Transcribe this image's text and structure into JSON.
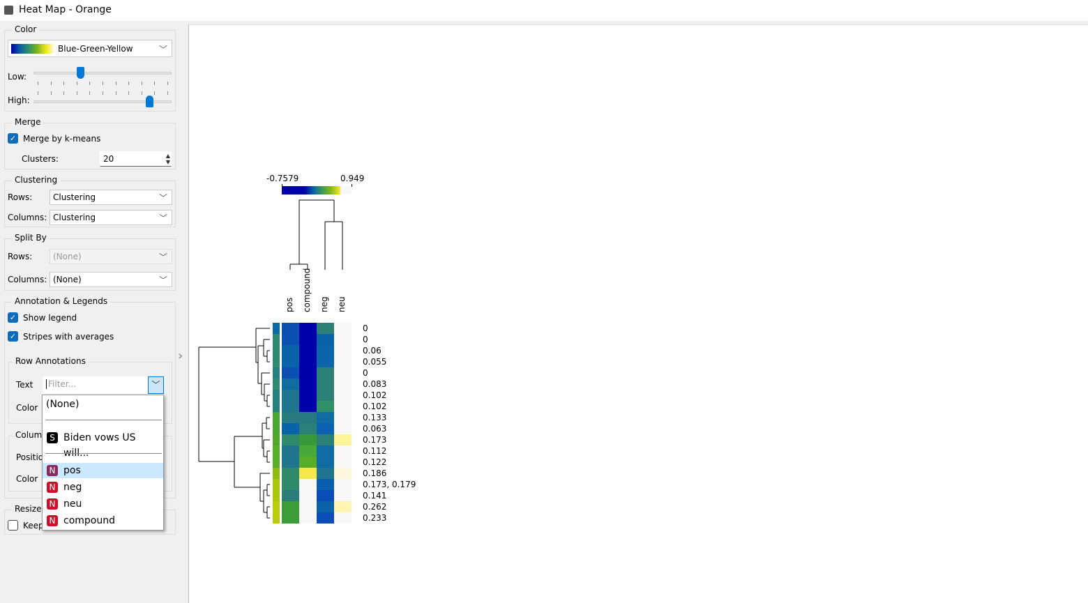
{
  "window": {
    "title": "Heat Map - Orange",
    "icon": "orange-app-icon"
  },
  "color": {
    "section": "Color",
    "palette": "Blue-Green-Yellow",
    "low_label": "Low:",
    "high_label": "High:",
    "low_value": 0.35,
    "high_value": 0.85
  },
  "merge": {
    "section": "Merge",
    "checkbox": "Merge by k-means",
    "checked": true,
    "clusters_label": "Clusters:",
    "clusters": "20"
  },
  "clustering": {
    "section": "Clustering",
    "rows_label": "Rows:",
    "rows": "Clustering",
    "columns_label": "Columns:",
    "columns": "Clustering"
  },
  "split": {
    "section": "Split By",
    "rows_label": "Rows:",
    "rows": "(None)",
    "columns_label": "Columns:",
    "columns": "(None)"
  },
  "annotation": {
    "section": "Annotation & Legends",
    "show_legend": "Show legend",
    "stripes": "Stripes with averages",
    "row_section": "Row Annotations",
    "text_label": "Text",
    "filter_placeholder": "Filter...",
    "color_label": "Color",
    "col_section": "Column",
    "position_label": "Positio",
    "col_color_label": "Color"
  },
  "resize": {
    "section": "Resize",
    "keep": "Keep"
  },
  "dropdown": {
    "none": "(None)",
    "items": [
      {
        "type": "S",
        "label": "Biden vows US will..."
      },
      {
        "type": "N",
        "label": "pos",
        "selected": true
      },
      {
        "type": "N",
        "label": "neg"
      },
      {
        "type": "N",
        "label": "neu"
      },
      {
        "type": "N",
        "label": "compound"
      }
    ]
  },
  "heatmap": {
    "legend_min": "-0.7579",
    "legend_max": "0.949",
    "columns": [
      "pos",
      "compound",
      "neg",
      "neu"
    ],
    "row_labels": [
      "0",
      "0",
      "0.06",
      "0.055",
      "0",
      "0.083",
      "0.102",
      "0.102",
      "0.133",
      "0.063",
      "0.173",
      "0.112",
      "0.122",
      "0.186",
      "0.173, 0.179",
      "0.141",
      "0.262",
      "0.233"
    ],
    "stripe_colors": [
      "#0a6aa8",
      "#2e8a70",
      "#2e8a70",
      "#2e8a70",
      "#26807e",
      "#2e8a70",
      "#26807e",
      "#26807e",
      "#48a830",
      "#48a830",
      "#50aa2a",
      "#58ae26",
      "#58ae26",
      "#8cbc10",
      "#acc80a",
      "#acc80a",
      "#b8cc0a",
      "#b8cc0a"
    ],
    "cell_colors": [
      [
        "#0b4fb0",
        "#0000aa",
        "#2d8078",
        "#f8f8f8"
      ],
      [
        "#0b4fb0",
        "#0000aa",
        "#0a62a8",
        "#f8f8f8"
      ],
      [
        "#0a62a8",
        "#0000aa",
        "#0c65a8",
        "#f8f8f8"
      ],
      [
        "#0a62a8",
        "#0000aa",
        "#0c65a8",
        "#f8f8f8"
      ],
      [
        "#0b4fb0",
        "#0000aa",
        "#2d8078",
        "#f8f8f8"
      ],
      [
        "#106ca0",
        "#0000aa",
        "#2d8078",
        "#f8f8f8"
      ],
      [
        "#1f7490",
        "#0000aa",
        "#2d8078",
        "#f8f8f8"
      ],
      [
        "#1f7490",
        "#0000aa",
        "#30906a",
        "#f8f8f8"
      ],
      [
        "#267a80",
        "#267a80",
        "#106aa4",
        "#f8f8f8"
      ],
      [
        "#0a62a8",
        "#2a8078",
        "#0a62b0",
        "#f8f8f8"
      ],
      [
        "#2e8a68",
        "#38983c",
        "#2a8078",
        "#fff39a"
      ],
      [
        "#20748e",
        "#48a838",
        "#106aa4",
        "#f8f8f8"
      ],
      [
        "#20748e",
        "#58ae28",
        "#106aa4",
        "#f8f8f8"
      ],
      [
        "#2e8a68",
        "#f4e84a",
        "#20748e",
        "#fdf8dc"
      ],
      [
        "#2e8a68",
        "#f8f8f8",
        "#0a5eb0",
        "#f8f8f8"
      ],
      [
        "#2a7e7a",
        "#f8f8f8",
        "#0a4cb8",
        "#f8f8f8"
      ],
      [
        "#3c9c38",
        "#f8f8f8",
        "#0a62a8",
        "#fff5b0"
      ],
      [
        "#3c9c38",
        "#f8f8f8",
        "#0a4cb8",
        "#f8f8f8"
      ]
    ]
  }
}
